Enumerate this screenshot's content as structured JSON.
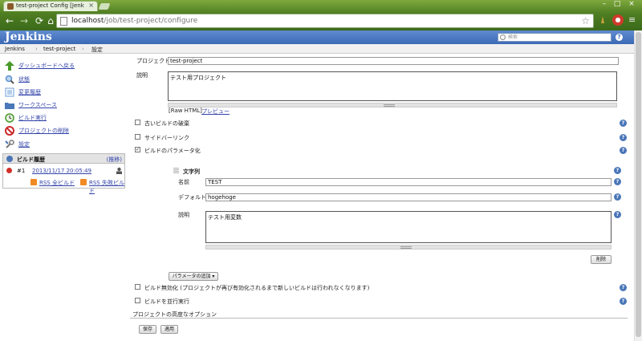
{
  "browser": {
    "tab_title": "test-project Config [Jenk",
    "url_host": "localhost",
    "url_path": "/job/test-project/configure"
  },
  "jenkins": {
    "logo": "Jenkins",
    "search_placeholder": "検索",
    "help": "?"
  },
  "breadcrumb": {
    "items": [
      "Jenkins",
      "test-project",
      "設定"
    ],
    "sep": "›"
  },
  "sidebar": {
    "items": [
      {
        "label": "ダッシュボードへ戻る",
        "icon": "up-arrow-icon",
        "color": "#4a9a2a"
      },
      {
        "label": "状態",
        "icon": "magnifier-icon",
        "color": "#5b8fd0"
      },
      {
        "label": "変更履歴",
        "icon": "notepad-icon",
        "color": "#6b9cd8"
      },
      {
        "label": "ワークスペース",
        "icon": "folder-icon",
        "color": "#4a78b8"
      },
      {
        "label": "ビルド実行",
        "icon": "clock-icon",
        "color": "#4a9a2a"
      },
      {
        "label": "プロジェクトの削除",
        "icon": "no-entry-icon",
        "color": "#cc2a2a"
      },
      {
        "label": "設定",
        "icon": "wrench-icon",
        "color": "#777777"
      }
    ]
  },
  "build_history": {
    "title": "ビルド履歴",
    "trend": "(推移)",
    "build_number": "#1",
    "build_date": "2013/11/17 20:05:49",
    "rss_all": "RSS 全ビルド",
    "rss_fail": "RSS 失敗ビルド"
  },
  "form": {
    "project_name_label": "プロジェクト名",
    "project_name_value": "test-project",
    "description_label": "説明",
    "description_value": "テスト用プロジェクト",
    "raw_html": "[Raw HTML]",
    "preview": "プレビュー",
    "discard_old_builds": "古いビルドの破棄",
    "sidebar_link": "サイドバーリンク",
    "parameterized": "ビルドのパラメータ化",
    "string_param_title": "文字列",
    "name_label": "名前",
    "name_value": "TEST",
    "default_label": "デフォルト値",
    "default_value": "hogehoge",
    "param_desc_label": "説明",
    "param_desc_value": "テスト用変数",
    "delete_button": "削除",
    "add_param_button": "パラメータの追加 ▾",
    "disable_build": "ビルド無効化 (プロジェクトが再び有効化されるまで新しいビルドは行われなくなります)",
    "concurrent_build": "ビルドを並行実行",
    "advanced_options": "プロジェクトの高度なオプション",
    "save_button": "保存",
    "apply_button": "適用",
    "check": "✓"
  }
}
